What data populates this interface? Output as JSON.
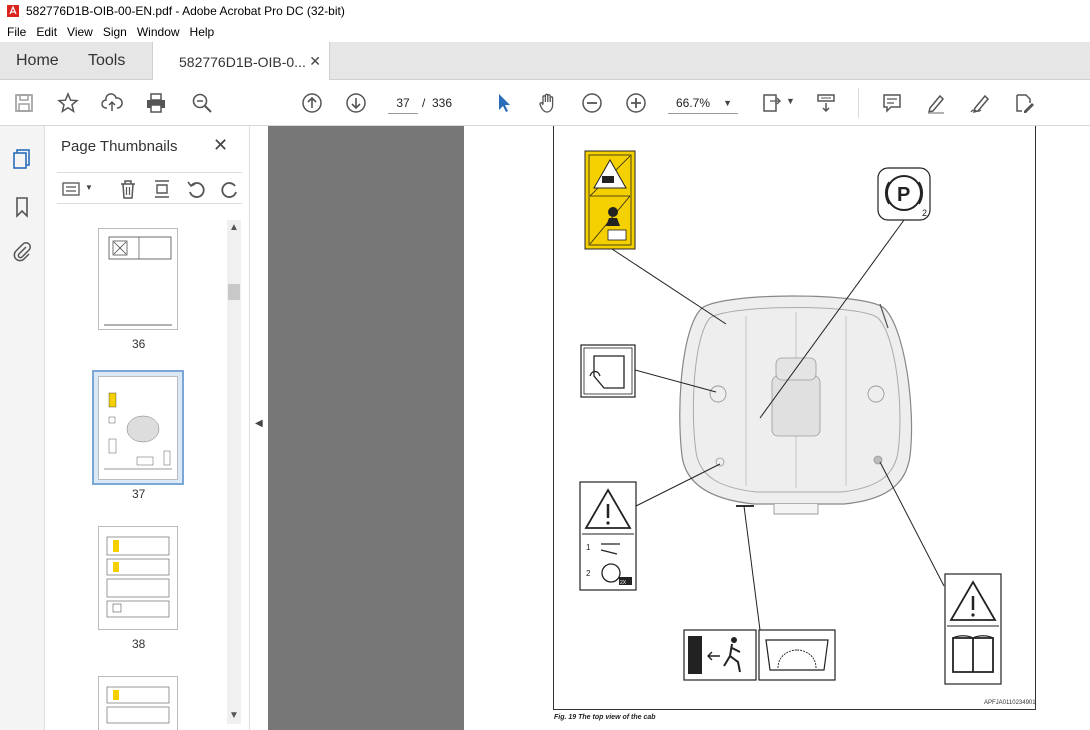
{
  "window": {
    "title": "582776D1B-OIB-00-EN.pdf - Adobe Acrobat Pro DC (32-bit)"
  },
  "menu": [
    "File",
    "Edit",
    "View",
    "Sign",
    "Window",
    "Help"
  ],
  "tabs": {
    "home": "Home",
    "tools": "Tools",
    "document": "582776D1B-OIB-0..."
  },
  "toolbar": {
    "current_page": "37",
    "page_separator": "/",
    "total_pages": "336",
    "zoom": "66.7%"
  },
  "thumbnails_panel": {
    "title": "Page Thumbnails",
    "pages": [
      "36",
      "37",
      "38"
    ],
    "selected_page": "37"
  },
  "document": {
    "caption": "Fig. 19  The top view of the cab",
    "figure_code": "APFJA0110234901",
    "parking_sign": "P",
    "parking_sub": "2",
    "label_1": "1",
    "label_2": "2",
    "label_2x": "2X"
  },
  "colors": {
    "accent_blue": "#2a6ebb",
    "warning_yellow": "#f5d000",
    "doc_bg": "#777777"
  }
}
